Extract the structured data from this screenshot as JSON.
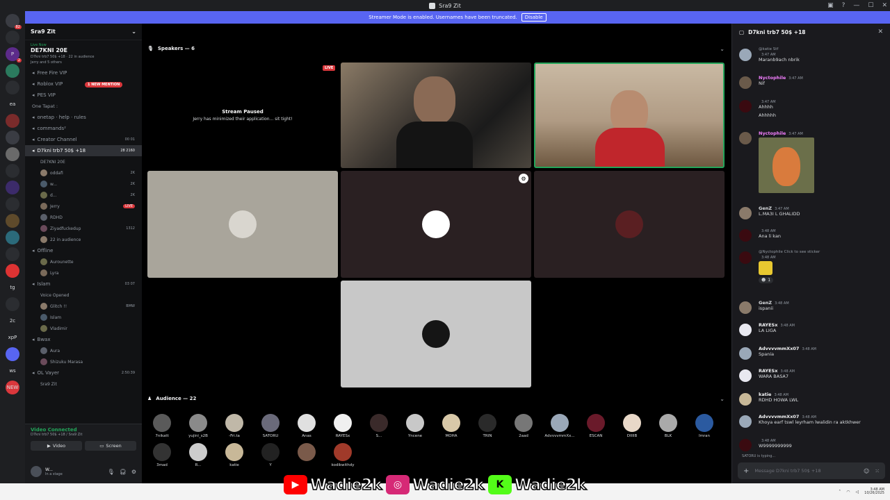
{
  "window": {
    "title": "Sra9 Zit"
  },
  "streamer_mode": {
    "message": "Streamer Mode is enabled. Usernames have been truncated.",
    "button": "Disable"
  },
  "server_rail": [
    {
      "label": "",
      "badge": "82"
    },
    {
      "label": "",
      "badge": ""
    },
    {
      "label": "P",
      "badge": "2"
    },
    {
      "label": "",
      "badge": ""
    },
    {
      "label": "",
      "badge": ""
    },
    {
      "label": "ea",
      "badge": ""
    },
    {
      "label": "",
      "badge": ""
    },
    {
      "label": "",
      "badge": ""
    },
    {
      "label": "",
      "badge": ""
    },
    {
      "label": "",
      "badge": ""
    },
    {
      "label": "",
      "badge": ""
    },
    {
      "label": "",
      "badge": ""
    },
    {
      "label": "",
      "badge": ""
    },
    {
      "label": "",
      "badge": ""
    },
    {
      "label": "",
      "badge": ""
    },
    {
      "label": "",
      "badge": ""
    },
    {
      "label": "tg",
      "badge": ""
    },
    {
      "label": "",
      "badge": ""
    },
    {
      "label": "2c",
      "badge": ""
    },
    {
      "label": "xpP",
      "badge": ""
    },
    {
      "label": "",
      "badge": ""
    },
    {
      "label": "ws",
      "badge": ""
    },
    {
      "label": "NEW",
      "badge": ""
    }
  ],
  "sidebar": {
    "server_name": "Sra9 Zit",
    "live": {
      "status": "Live Now",
      "channel": "DE7KNI 20E",
      "info": "D7kni trb7 50$ +18 · 22 in audience",
      "people": "Jerry and 5 others"
    },
    "mention": "1 NEW MENTION",
    "rows": [
      {
        "kind": "chan",
        "label": "Free Fire VIP",
        "right": ""
      },
      {
        "kind": "chan",
        "label": "Roblox VIP",
        "right": ""
      },
      {
        "kind": "chan",
        "label": "PES VIP",
        "right": ""
      },
      {
        "kind": "cat",
        "label": "One Tapat :",
        "right": ""
      },
      {
        "kind": "chan",
        "label": "onetap · help · rules",
        "right": ""
      },
      {
        "kind": "chan",
        "label": "commands²",
        "right": ""
      },
      {
        "kind": "chan",
        "label": "Creator Channel",
        "right": "00  01"
      },
      {
        "kind": "active",
        "label": "D7kni trb7 50$ +18",
        "right": "28  2160"
      },
      {
        "kind": "subtext",
        "label": "DE7KNI 20E",
        "right": ""
      },
      {
        "kind": "user",
        "label": "oddafi",
        "right": "2K"
      },
      {
        "kind": "user",
        "label": "w...",
        "right": "2K"
      },
      {
        "kind": "user",
        "label": "d...",
        "right": "2K"
      },
      {
        "kind": "user",
        "label": "Jerry",
        "right": "LIVE"
      },
      {
        "kind": "user",
        "label": "RDHD",
        "right": ""
      },
      {
        "kind": "user",
        "label": "Ziyadfuckedup",
        "right": "1312"
      },
      {
        "kind": "user",
        "label": "22 in audience",
        "right": ""
      },
      {
        "kind": "chan",
        "label": "Offline",
        "right": ""
      },
      {
        "kind": "user",
        "label": "Aurounette",
        "right": ""
      },
      {
        "kind": "user",
        "label": "Lyra",
        "right": ""
      },
      {
        "kind": "chan",
        "label": "Islam",
        "right": "03  07"
      },
      {
        "kind": "subtext",
        "label": "Voice Opened",
        "right": ""
      },
      {
        "kind": "user",
        "label": "Glitch !!",
        "right": "BMW"
      },
      {
        "kind": "user",
        "label": "Islam",
        "right": ""
      },
      {
        "kind": "user",
        "label": "Vladimir",
        "right": ""
      },
      {
        "kind": "chan",
        "label": "Bwax",
        "right": ""
      },
      {
        "kind": "user",
        "label": "Aura",
        "right": ""
      },
      {
        "kind": "user",
        "label": "Shizuku Marasa",
        "right": ""
      },
      {
        "kind": "chan",
        "label": "OL Vayer",
        "right": "2:50:39"
      },
      {
        "kind": "subtext",
        "label": "Sra9 Zit",
        "right": ""
      }
    ],
    "voice_panel": {
      "title": "Video Connected",
      "subtitle": "D7kni trb7 50$ +18 / Sra9 Zit",
      "video_btn": "Video",
      "screen_btn": "Screen"
    },
    "user": {
      "name": "W...",
      "status": "In a stage"
    }
  },
  "stage": {
    "speakers_header": "Speakers — 6",
    "paused_title": "Stream Paused",
    "paused_sub": "Jerry has minimized their application... sit tight!",
    "live_tag": "LIVE",
    "audience_header": "Audience — 22",
    "audience": [
      "7nikatt",
      "yujini_s2B",
      "-Fri.ta",
      "SATORU",
      "Anas",
      "RAYESx",
      "S...",
      "Yncene",
      "MOHA",
      "TRIN",
      "2aad",
      "AdvvvvmmXx...",
      "ESCAN",
      "DIIIIB",
      "BLK",
      "Imran",
      "3mad",
      "R...",
      "katie",
      "Y",
      "",
      "kodikwithdy"
    ]
  },
  "chat": {
    "header": "D7kni trb7 50$ +18",
    "messages": [
      {
        "name": "",
        "reply": "@katie Stf",
        "time": "3:47 AM",
        "text": "Maranb9ach nbrik",
        "color": "#dbdee1"
      },
      {
        "name": "Nyctophile",
        "reply": "",
        "time": "3:47 AM",
        "text": "Nif",
        "color": "#f47fff"
      },
      {
        "name": "",
        "reply": "",
        "time": "3:47 AM",
        "text": "Ahhhh",
        "color": "#dbdee1"
      },
      {
        "name": "",
        "reply": "",
        "time": "",
        "text": "Ahhhhh",
        "color": "#dbdee1"
      },
      {
        "name": "Nyctophile",
        "reply": "",
        "time": "3:47 AM",
        "text": "",
        "color": "#f47fff"
      },
      {
        "name": "GenZ",
        "reply": "",
        "time": "3:47 AM",
        "text": "L.MA3I L GHALIDD",
        "color": "#dbdee1"
      },
      {
        "name": "",
        "reply": "",
        "time": "3:48 AM",
        "text": "Ana li kan",
        "color": "#dbdee1"
      },
      {
        "name": "",
        "reply": "@Nyctophile Click to see sticker",
        "time": "3:48 AM",
        "text": "",
        "color": "#dbdee1"
      },
      {
        "name": "GenZ",
        "reply": "",
        "time": "3:48 AM",
        "text": "ispanii",
        "color": "#dbdee1"
      },
      {
        "name": "RAYESx",
        "reply": "",
        "time": "3:48 AM",
        "text": "LA LIGA",
        "color": "#f2f3f5"
      },
      {
        "name": "AdvvvvmmXx07",
        "reply": "",
        "time": "3:48 AM",
        "text": "Spania",
        "color": "#f2f3f5"
      },
      {
        "name": "RAYESx",
        "reply": "",
        "time": "3:48 AM",
        "text": "WARA BASA7",
        "color": "#f2f3f5"
      },
      {
        "name": "katie",
        "reply": "",
        "time": "3:48 AM",
        "text": "RDHD HOWA LWL",
        "color": "#f2f3f5"
      },
      {
        "name": "AdvvvvmmXx07",
        "reply": "",
        "time": "3:48 AM",
        "text": "Khoya earf tswl leyrham lwalidin ra aktkhwer",
        "color": "#f2f3f5"
      },
      {
        "name": "",
        "reply": "",
        "time": "3:48 AM",
        "text": "W9999999999",
        "color": "#dbdee1"
      }
    ],
    "reaction_count": "1",
    "typing": "SATORU is typing...",
    "placeholder": "Message D7kni trb7 50$ +18"
  },
  "overlay": [
    {
      "platform": "youtube",
      "handle": "Wadie2k",
      "color": "#ff0000"
    },
    {
      "platform": "instagram",
      "handle": "Wadie2k",
      "color": "#d62976"
    },
    {
      "platform": "kick",
      "handle": "Wadie2k",
      "color": "#53fc18"
    }
  ],
  "taskbar": {
    "time": "3:48 AM",
    "date": "10/26/2025"
  }
}
